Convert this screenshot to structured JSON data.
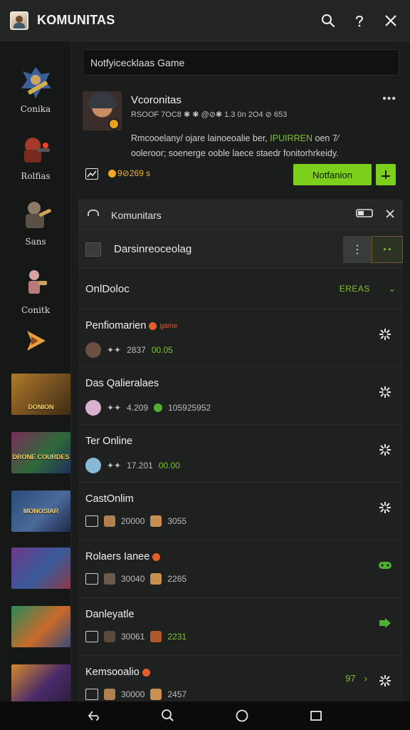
{
  "app": {
    "title": "KOMUNITAS"
  },
  "header": {
    "icons": [
      "search-icon",
      "help-icon",
      "close-icon"
    ]
  },
  "sidebar": {
    "items": [
      {
        "label": "Conika",
        "icon": "robot-warrior-icon"
      },
      {
        "label": "Rolfias",
        "icon": "red-mech-icon"
      },
      {
        "label": "Sans",
        "icon": "armored-hero-icon"
      },
      {
        "label": "Conitk",
        "icon": "fighter-icon"
      },
      {
        "label": "",
        "icon": "play-arrow-icon"
      }
    ],
    "thumbnails": [
      {
        "text": "DONION"
      },
      {
        "text": "DRONE COURDES"
      },
      {
        "text": "MONOSIAR"
      },
      {
        "text": ""
      },
      {
        "text": ""
      },
      {
        "text": ""
      }
    ]
  },
  "search": {
    "placeholder": "Notfyicecklaas Game"
  },
  "post": {
    "name": "Vcoronitas",
    "meta": "RSOOF 7OC8 ✱ ✱ @⊘✱ 1.3 0n 2O4 ⊘ 653",
    "text_line1": "Rmcooelany/ ojare lainoeoalie ber,",
    "text_line1_green": "IPUIRREN",
    "text_line1_end": "oen 7⁄",
    "text_line2": "ooleroor; soenerge ooble laece staedr fonitorhrkeidy.",
    "coin_value": "9⊘269 s",
    "notif_label": "Notfanion"
  },
  "panel": {
    "title": "Komunitars",
    "sub_label": "Darsinreoceolag",
    "online_label": "OnlDoloc",
    "sort_label": "EREAS",
    "sort_chev": "⌄"
  },
  "games": [
    {
      "name": "Penfiomarien",
      "tag": "game",
      "stat1": "2837",
      "stat2": "00.05",
      "stat2_green": true,
      "icon": "gear-star-icon"
    },
    {
      "name": "Das Qalieralaes",
      "tag": "",
      "stat1": "4.209",
      "stat2": "105925952",
      "stat2_green": false,
      "icon": "gear-star-icon"
    },
    {
      "name": "Ter Online",
      "tag": "",
      "stat1": "17.201",
      "stat2": "00.00",
      "stat2_green": true,
      "icon": "gear-star-icon"
    },
    {
      "name": "CastOnlim",
      "tag": "",
      "stat1": "20000",
      "stat2": "3055",
      "stat2_green": false,
      "icon": "gear-star-icon"
    },
    {
      "name": "Rolaers Ianee",
      "tag": "",
      "stat1": "30040",
      "stat2": "2265",
      "stat2_green": false,
      "icon": "green-controller-icon"
    },
    {
      "name": "Danleyatle",
      "tag": "",
      "stat1": "30061",
      "stat2": "2231",
      "stat2_green": true,
      "icon": "green-arrow-icon"
    },
    {
      "name": "Kemsooalio",
      "tag": "",
      "stat1": "30000",
      "stat2": "2457",
      "stat2_green": false,
      "icon": "gear-star-icon",
      "extra": "97"
    }
  ],
  "bottom_nav": {
    "icons": [
      "back-icon",
      "search-icon",
      "home-circle-icon",
      "recents-square-icon"
    ]
  },
  "colors": {
    "accent": "#7ccf1a",
    "background": "#1b1c1c",
    "sidebar": "#161717",
    "coin": "#f2a921"
  }
}
